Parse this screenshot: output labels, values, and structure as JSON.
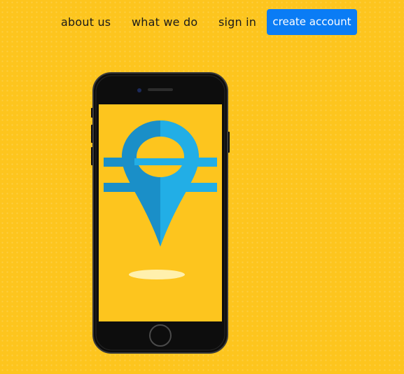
{
  "nav": {
    "about_label": "about us",
    "what_label": "what we do",
    "sign_in_label": "sign in",
    "create_account_label": "create account"
  },
  "hero": {
    "device_icon": "smartphone-icon",
    "logo_icon": "currency-location-pin-icon"
  },
  "colors": {
    "background": "#fdc51e",
    "accent": "#0a7cf5",
    "pin_light": "#22aee6",
    "pin_dark": "#1a8fc8",
    "phone_body": "#0d0d0d"
  }
}
